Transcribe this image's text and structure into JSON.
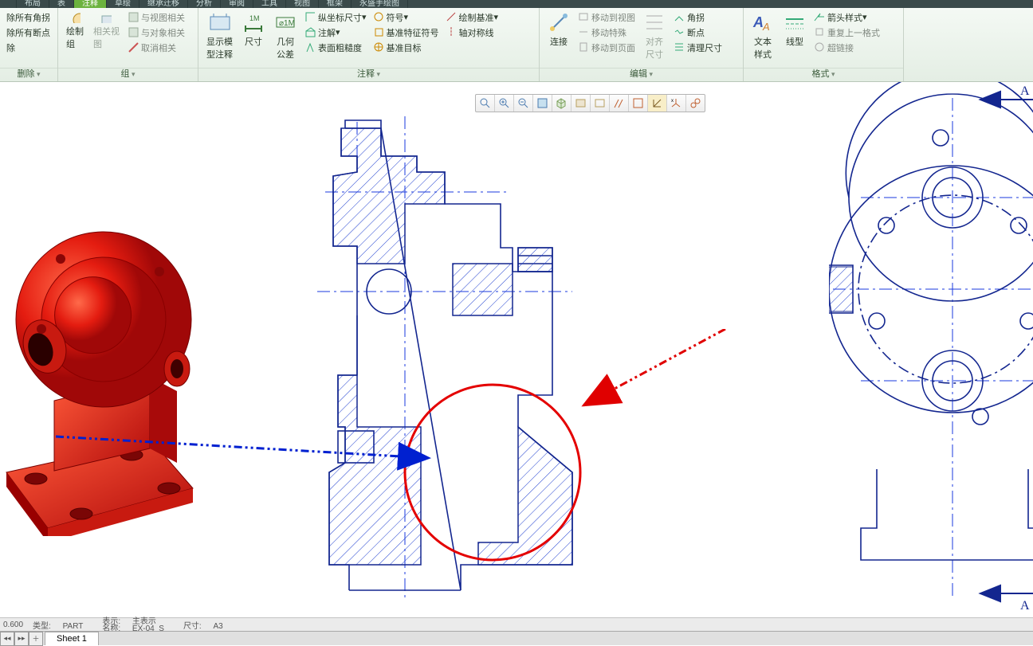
{
  "tabs": [
    "",
    "布局",
    "表",
    "注释",
    "草绘",
    "继承迁移",
    "分析",
    "审阅",
    "工具",
    "视图",
    "框架",
    "永盛手绘图"
  ],
  "active_tab": "注释",
  "ribbon": {
    "group_delete": {
      "items": [
        "除所有角拐",
        "除所有断点",
        "除"
      ],
      "label": "删除"
    },
    "group_group": {
      "big1": "绘制\n组",
      "big2": "相关视\n图",
      "col": [
        "与视图相关",
        "与对象相关",
        "取消相关"
      ],
      "label": "组"
    },
    "group_annot": {
      "big1": "显示模\n型注释",
      "big2": "尺寸\n",
      "big3": "几何\n公差",
      "col": [
        "纵坐标尺寸",
        "注解",
        "表面粗糙度"
      ],
      "col2": [
        "符号",
        "基准特征符号",
        "基准目标"
      ],
      "col3": [
        "绘制基准",
        "轴对称线"
      ],
      "label": "注释"
    },
    "group_edit": {
      "big1": "连接",
      "col": [
        "移动到视图",
        "移动特殊",
        "移动到页面"
      ],
      "big2": "对齐\n尺寸",
      "col2": [
        "角拐",
        "断点",
        "清理尺寸"
      ],
      "label": "编辑"
    },
    "group_format": {
      "big1": "文本\n样式",
      "big2": "线型",
      "col": [
        "箭头样式",
        "重复上一格式",
        "超链接"
      ],
      "label": "格式"
    }
  },
  "status": {
    "scale": "0.600",
    "type_label": "类型:",
    "type_value": "PART",
    "show_label": "表示:",
    "show_value": "主表示",
    "name_label": "名称:",
    "name_value": "EX-04_S",
    "size_label": "尺寸:",
    "size_value": "A3"
  },
  "sheet": "Sheet 1",
  "section_label": "A"
}
